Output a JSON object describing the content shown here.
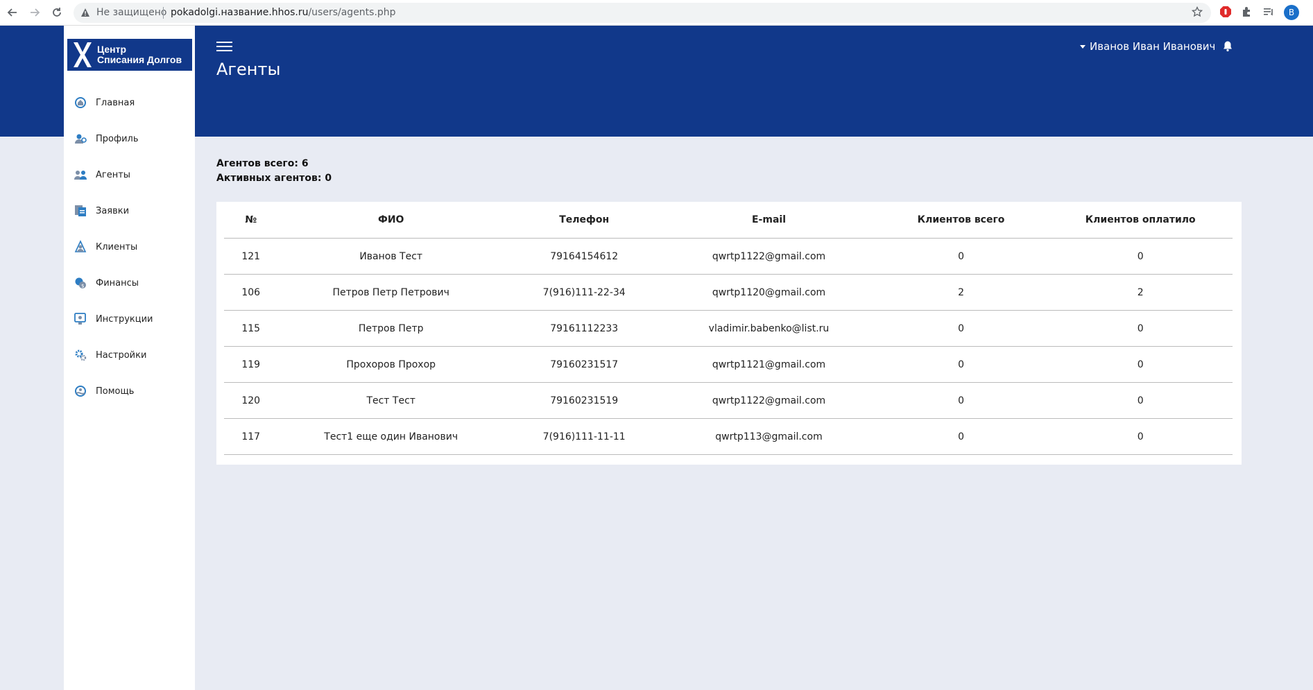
{
  "browser": {
    "insecure_label": "Не защищено",
    "url_host": "pokadolgi.название.hhos.ru",
    "url_path": "/users/agents.php",
    "profile_initial": "B"
  },
  "header": {
    "title": "Агенты",
    "user_name": "Иванов Иван Иванович"
  },
  "logo": {
    "line1": "Центр",
    "line2": "Списания Долгов"
  },
  "sidebar": {
    "items": [
      {
        "label": "Главная",
        "icon": "home-icon"
      },
      {
        "label": "Профиль",
        "icon": "profile-icon"
      },
      {
        "label": "Агенты",
        "icon": "agents-icon"
      },
      {
        "label": "Заявки",
        "icon": "requests-icon"
      },
      {
        "label": "Клиенты",
        "icon": "clients-icon"
      },
      {
        "label": "Финансы",
        "icon": "finance-icon"
      },
      {
        "label": "Инструкции",
        "icon": "instructions-icon"
      },
      {
        "label": "Настройки",
        "icon": "settings-icon"
      },
      {
        "label": "Помощь",
        "icon": "help-icon"
      }
    ]
  },
  "stats": {
    "total": "Агентов всего: 6",
    "active": "Активных агентов: 0"
  },
  "table": {
    "headers": [
      "№",
      "ФИО",
      "Телефон",
      "E-mail",
      "Клиентов всего",
      "Клиентов оплатило"
    ],
    "rows": [
      [
        "121",
        "Иванов Тест",
        "79164154612",
        "qwrtp1122@gmail.com",
        "0",
        "0"
      ],
      [
        "106",
        "Петров Петр Петрович",
        "7(916)111-22-34",
        "qwrtp1120@gmail.com",
        "2",
        "2"
      ],
      [
        "115",
        "Петров Петр",
        "79161112233",
        "vladimir.babenko@list.ru",
        "0",
        "0"
      ],
      [
        "119",
        "Прохоров Прохор",
        "79160231517",
        "qwrtp1121@gmail.com",
        "0",
        "0"
      ],
      [
        "120",
        "Тест Тест",
        "79160231519",
        "qwrtp1122@gmail.com",
        "0",
        "0"
      ],
      [
        "117",
        "Тест1 еще один Иванович",
        "7(916)111-11-11",
        "qwrtp113@gmail.com",
        "0",
        "0"
      ]
    ]
  },
  "colors": {
    "brand": "#11388a",
    "background": "#e8ebf3",
    "icon_accent": "#2d7dc3"
  }
}
